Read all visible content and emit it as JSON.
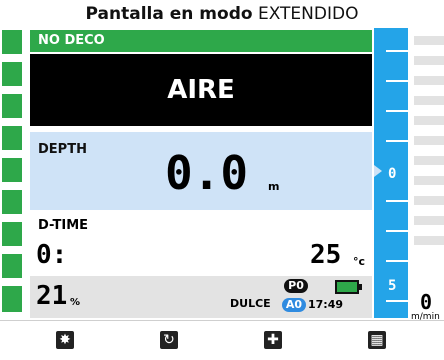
{
  "caption": {
    "prefix": "Pantalla en modo",
    "mode": "EXTENDIDO"
  },
  "status": {
    "no_deco": "NO DECO",
    "gas": "AIRE"
  },
  "depth": {
    "label": "DEPTH",
    "value": "0.0",
    "unit": "m"
  },
  "dive_time": {
    "label": "D-TIME",
    "value": "0:"
  },
  "temperature": {
    "value": "25",
    "unit": "°c"
  },
  "oxygen": {
    "value": "21",
    "unit": "%"
  },
  "water_type": "DULCE",
  "profile_badges": {
    "p": "P0",
    "a": "A0"
  },
  "clock": "17:49",
  "battery": {
    "level": 1.0,
    "color": "#2ea84a"
  },
  "scale": {
    "mark_zero": "0",
    "mark_five": "5"
  },
  "ascent_rate": {
    "value": "0",
    "unit": "m/min"
  },
  "buttons": [
    {
      "icon": "light-icon",
      "glyph": "✸"
    },
    {
      "icon": "refresh-icon",
      "glyph": "↻"
    },
    {
      "icon": "plus-icon",
      "glyph": "✚"
    },
    {
      "icon": "grid-icon",
      "glyph": "▦"
    }
  ],
  "colors": {
    "green": "#2ea84a",
    "blue": "#24a4e8",
    "light_blue": "#cfe3f7"
  }
}
